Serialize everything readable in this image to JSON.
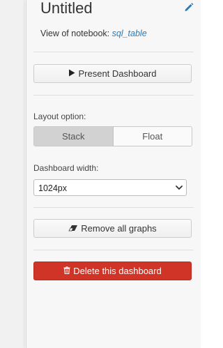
{
  "panel": {
    "title": "Untitled",
    "subtitle_prefix": "View of notebook: ",
    "notebook_link": "sql_table"
  },
  "actions": {
    "present_label": "Present Dashboard",
    "remove_label": "Remove all graphs",
    "delete_label": "Delete this dashboard"
  },
  "layout": {
    "label": "Layout option:",
    "options": [
      "Stack",
      "Float"
    ],
    "selected": "Stack"
  },
  "width": {
    "label": "Dashboard width:",
    "value": "1024px"
  },
  "icons": {
    "edit": "pencil-icon",
    "present": "play-icon",
    "remove": "eraser-icon",
    "delete": "trash-icon",
    "dropdown": "chevron-down-icon"
  },
  "colors": {
    "link": "#2a7ab9",
    "danger": "#cf3426",
    "segment_active": "#d2d2d2"
  }
}
